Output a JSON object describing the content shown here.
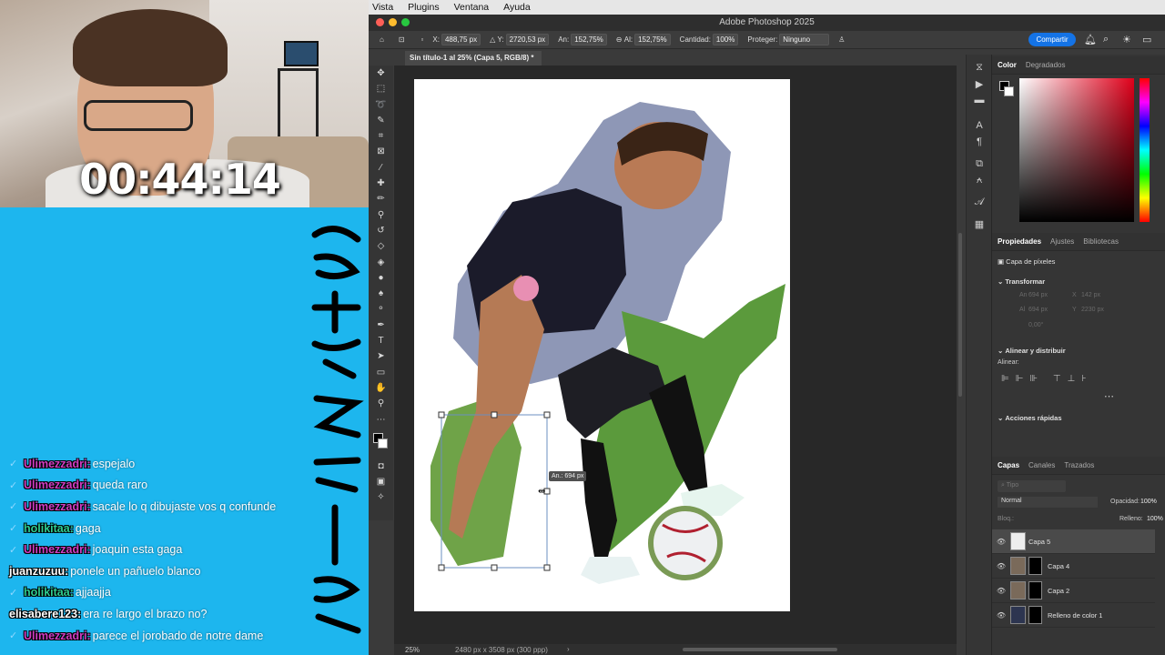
{
  "stream": {
    "timer": "00:44:14",
    "chat": [
      {
        "user": "Ulimezzadri:",
        "user_color": "#d03ec2",
        "message": "espejalo",
        "check": true
      },
      {
        "user": "Ulimezzadri:",
        "user_color": "#d03ec2",
        "message": "queda raro",
        "check": true
      },
      {
        "user": "Ulimezzadri:",
        "user_color": "#d03ec2",
        "message": "sacale lo q dibujaste vos q confunde",
        "check": true
      },
      {
        "user": "holikitaa:",
        "user_color": "#2ecc8f",
        "message": "gaga",
        "check": true
      },
      {
        "user": "Ulimezzadri:",
        "user_color": "#d03ec2",
        "message": "joaquin esta gaga",
        "check": true
      },
      {
        "user": "juanzuzuu:",
        "user_color": "#ffffff",
        "message": "ponele un pañuelo blanco",
        "check": false
      },
      {
        "user": "holikitaa:",
        "user_color": "#2ecc8f",
        "message": "ajjaajja",
        "check": true
      },
      {
        "user": "elisabere123:",
        "user_color": "#ffffff",
        "message": "era re largo el brazo no?",
        "check": false
      },
      {
        "user": "Ulimezzadri:",
        "user_color": "#d03ec2",
        "message": "parece el jorobado de notre dame",
        "check": true
      }
    ]
  },
  "menubar": [
    "Vista",
    "Plugins",
    "Ventana",
    "Ayuda"
  ],
  "app_title": "Adobe Photoshop 2025",
  "options": {
    "x_label": "X:",
    "x_value": "488,75 px",
    "y_label": "Y:",
    "y_value": "2720,53 px",
    "w_label": "An:",
    "w_value": "152,75%",
    "h_label": "Al:",
    "h_value": "152,75%",
    "amount_label": "Cantidad:",
    "amount_value": "100%",
    "protect_label": "Proteger:",
    "protect_value": "Ninguno"
  },
  "share_label": "Compartir",
  "document_tab": "Sin título-1 al 25% (Capa 5, RGB/8) *",
  "transform_tooltip": "An.: 694 px",
  "status": {
    "zoom": "25%",
    "doc_info": "2480 px x 3508 px (300 ppp)"
  },
  "color_panel": {
    "tabs": [
      "Color",
      "Degradados"
    ]
  },
  "properties_panel": {
    "tabs": [
      "Propiedades",
      "Ajustes",
      "Bibliotecas"
    ],
    "layer_type": "Capa de píxeles",
    "transform_title": "Transformar",
    "transform_fields": [
      "An",
      "X",
      "Al",
      "Y"
    ],
    "transform_values": [
      "694 px",
      "142 px",
      "694 px",
      "2230 px"
    ],
    "angle_value": "0,00°",
    "align_title": "Alinear y distribuir",
    "align_label": "Alinear:",
    "quick_title": "Acciones rápidas"
  },
  "layers_panel": {
    "tabs": [
      "Capas",
      "Canales",
      "Trazados"
    ],
    "search_placeholder": "Tipo",
    "blend_mode": "Normal",
    "opacity_label": "Opacidad:",
    "opacity_value": "100%",
    "lock_label": "Bloq.:",
    "fill_label": "Relleno:",
    "fill_value": "100%",
    "layers": [
      {
        "name": "Capa 5",
        "selected": true
      },
      {
        "name": "Capa 4",
        "selected": false
      },
      {
        "name": "Capa 2",
        "selected": false
      },
      {
        "name": "Relleno de color 1",
        "selected": false
      }
    ]
  }
}
